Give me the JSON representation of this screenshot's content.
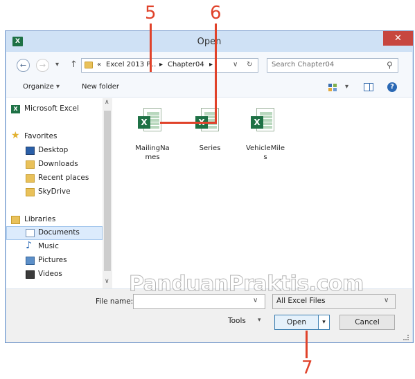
{
  "annotations": {
    "callout_5": "5",
    "callout_6": "6",
    "callout_7": "7",
    "watermark": "PanduanPraktis.com"
  },
  "window": {
    "title": "Open",
    "app_icon": "excel-icon",
    "close_glyph": "✕"
  },
  "nav": {
    "back_glyph": "←",
    "forward_glyph": "→",
    "recent_glyph": "▾",
    "up_glyph": "↑",
    "breadcrumb": [
      "«",
      "Excel 2013 P...",
      "▸",
      "Chapter04",
      "▸"
    ],
    "address_dropdown_glyph": "∨",
    "refresh_glyph": "↻",
    "search_placeholder": "Search Chapter04",
    "search_glyph": "⚲"
  },
  "toolbar": {
    "organize_label": "Organize",
    "organize_glyph": "▾",
    "new_folder_label": "New folder",
    "view_glyph": "▾",
    "help_glyph": "?"
  },
  "sidebar": {
    "items": [
      {
        "label": "Microsoft Excel",
        "icon": "excel-icon",
        "level": "top"
      },
      {
        "label": "Favorites",
        "icon": "star-icon",
        "level": "top"
      },
      {
        "label": "Desktop",
        "icon": "desktop-icon",
        "level": "child"
      },
      {
        "label": "Downloads",
        "icon": "downloads-icon",
        "level": "child"
      },
      {
        "label": "Recent places",
        "icon": "recent-places-icon",
        "level": "child"
      },
      {
        "label": "SkyDrive",
        "icon": "skydrive-icon",
        "level": "child"
      },
      {
        "label": "Libraries",
        "icon": "libraries-icon",
        "level": "top"
      },
      {
        "label": "Documents",
        "icon": "documents-icon",
        "level": "child",
        "selected": true
      },
      {
        "label": "Music",
        "icon": "music-icon",
        "level": "child"
      },
      {
        "label": "Pictures",
        "icon": "pictures-icon",
        "level": "child"
      },
      {
        "label": "Videos",
        "icon": "videos-icon",
        "level": "child"
      }
    ],
    "scroll_up_glyph": "∧",
    "scroll_down_glyph": "∨"
  },
  "files": [
    {
      "name_line1": "MailingNa",
      "name_line2": "mes",
      "icon": "excel-file-icon"
    },
    {
      "name_line1": "Series",
      "name_line2": "",
      "icon": "excel-file-icon"
    },
    {
      "name_line1": "VehicleMile",
      "name_line2": "s",
      "icon": "excel-file-icon"
    }
  ],
  "bottom": {
    "file_name_label": "File name:",
    "file_name_value": "",
    "file_name_dropdown_glyph": "∨",
    "file_type_value": "All Excel Files",
    "file_type_dropdown_glyph": "∨",
    "tools_label": "Tools",
    "tools_glyph": "▾",
    "open_label": "Open",
    "open_split_glyph": "▾",
    "cancel_label": "Cancel"
  },
  "colors": {
    "accent": "#e0422a",
    "excel_green": "#1e7145",
    "window_frame": "#cfe1f5",
    "close_button": "#c7463f"
  }
}
